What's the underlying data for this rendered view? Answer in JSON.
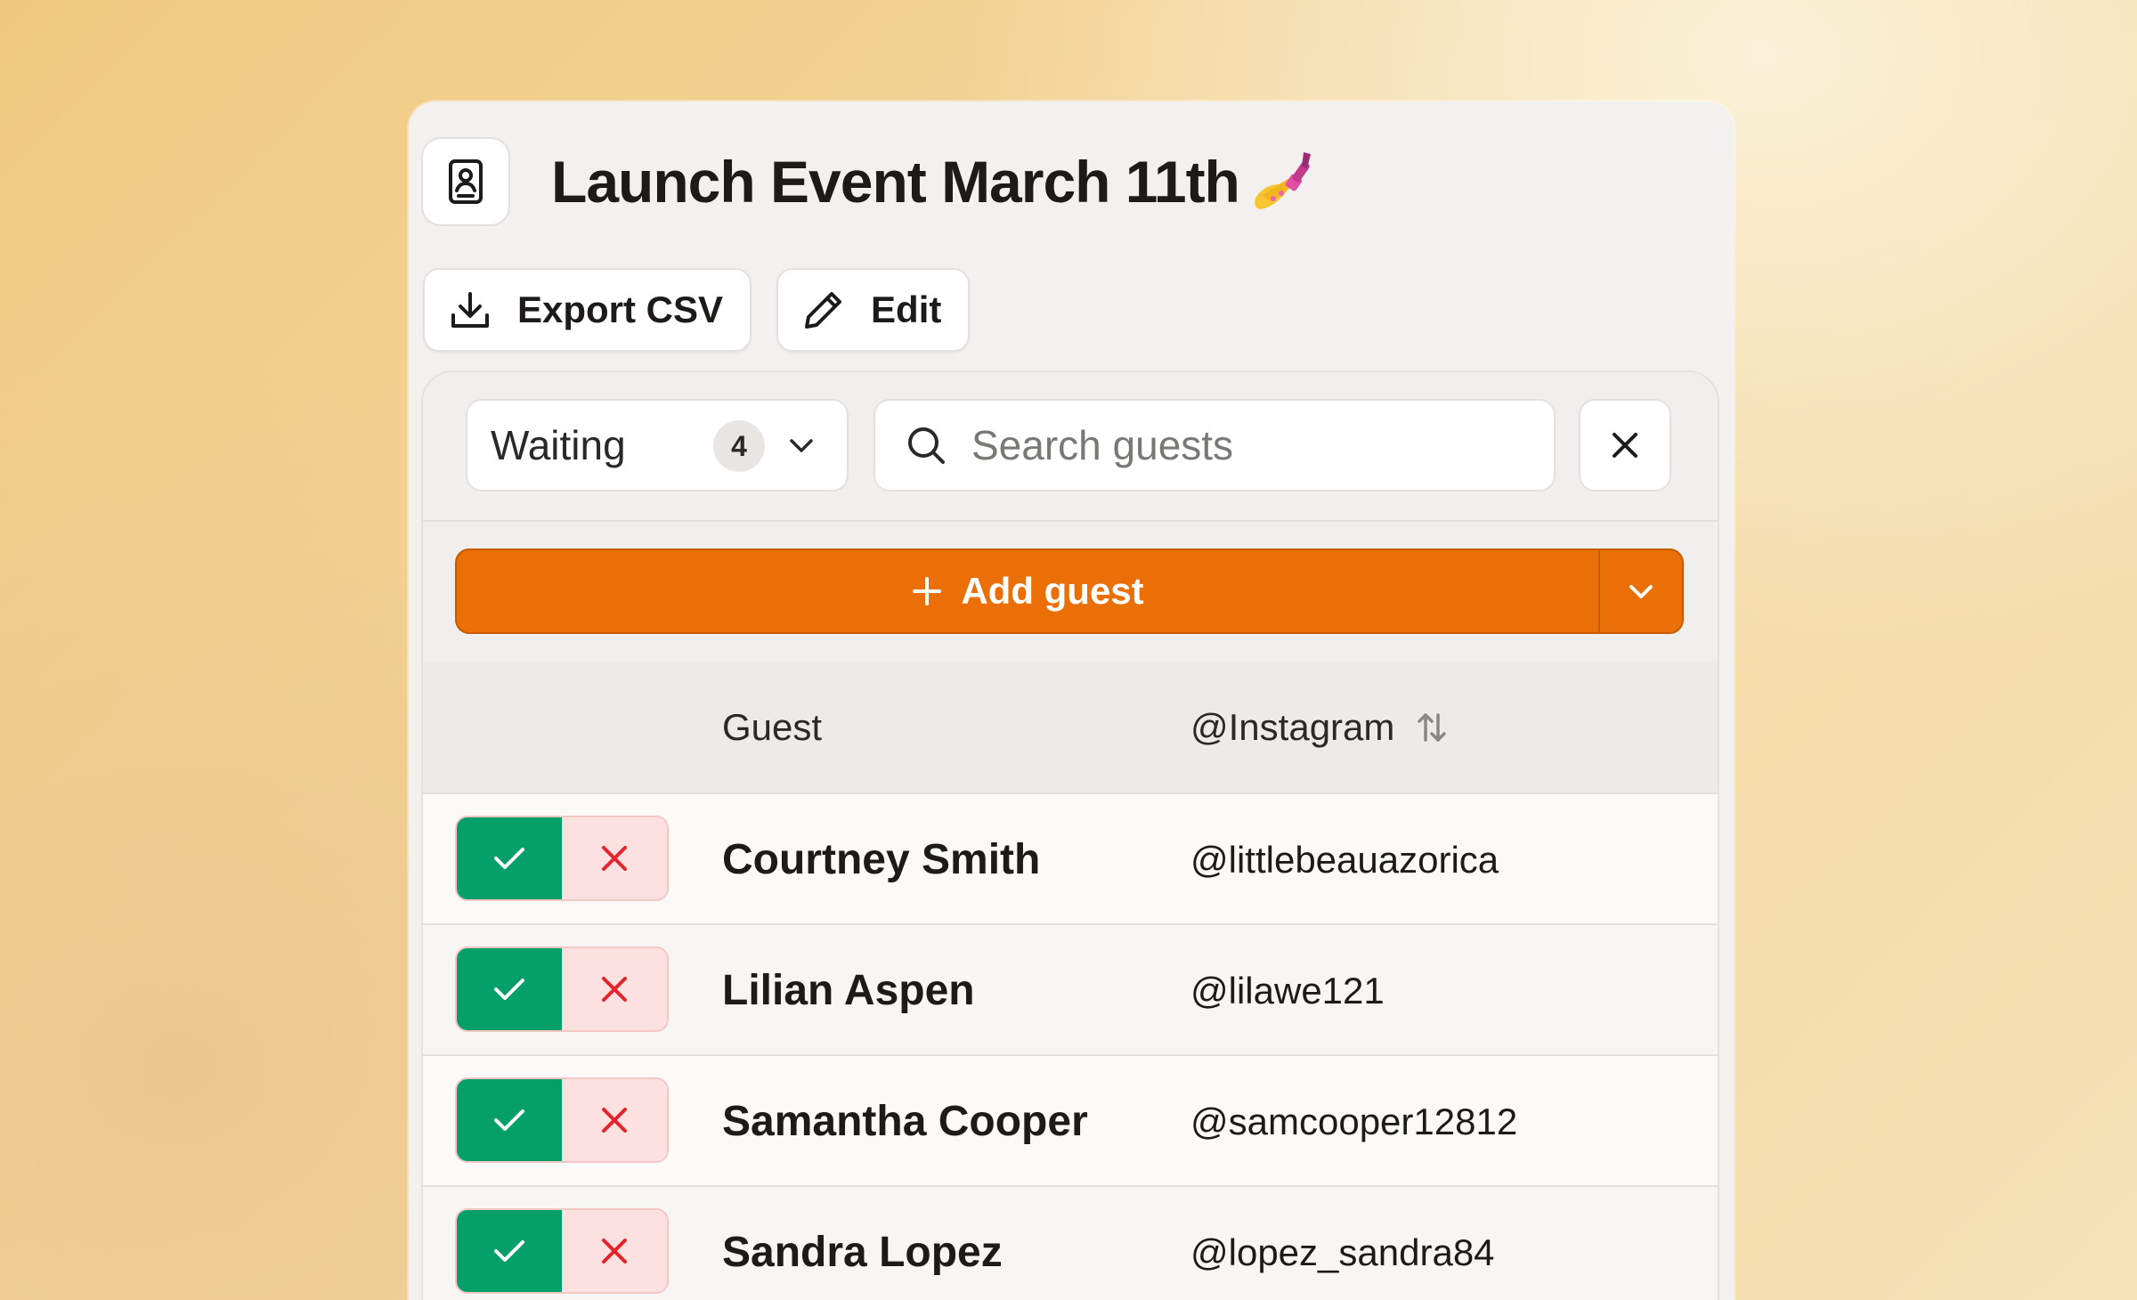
{
  "header": {
    "title": "Launch Event March 11th"
  },
  "toolbar": {
    "export_label": "Export CSV",
    "edit_label": "Edit"
  },
  "filters": {
    "status_value": "Waiting",
    "status_count": "4",
    "search_placeholder": "Search guests"
  },
  "add_guest": {
    "label": "Add guest"
  },
  "colors": {
    "accent": "#ea6f07",
    "approve": "#05a06a",
    "reject_bg": "#fde1e0",
    "reject_icon": "#e5232b"
  },
  "table": {
    "columns": [
      {
        "label": "Guest"
      },
      {
        "label": "@Instagram"
      }
    ],
    "rows": [
      {
        "name": "Courtney Smith",
        "instagram": "@littlebeauazorica"
      },
      {
        "name": "Lilian Aspen",
        "instagram": "@lilawe121"
      },
      {
        "name": "Samantha Cooper",
        "instagram": "@samcooper12812"
      },
      {
        "name": "Sandra Lopez",
        "instagram": "@lopez_sandra84"
      }
    ]
  }
}
